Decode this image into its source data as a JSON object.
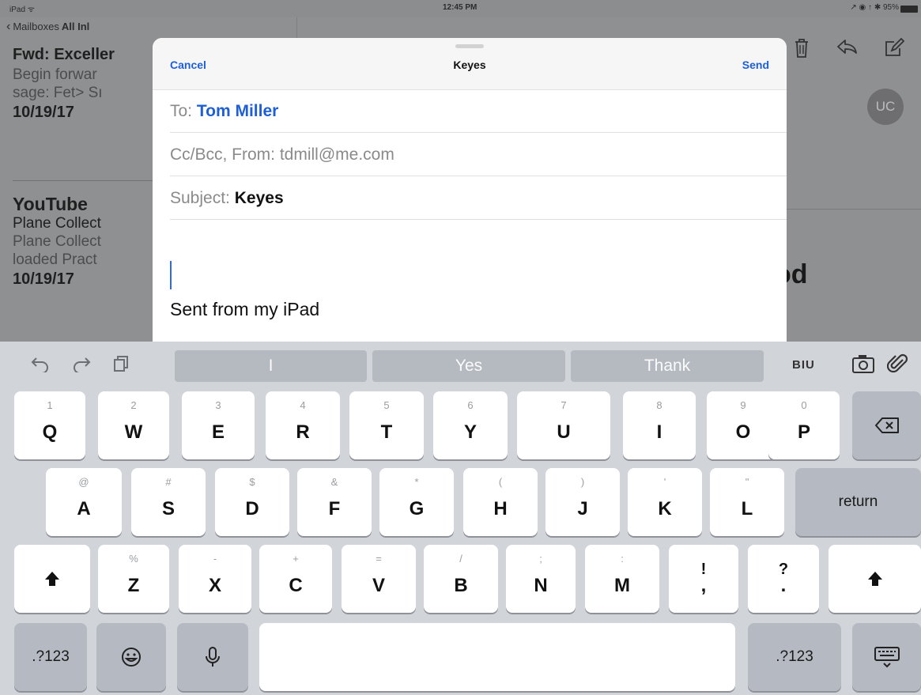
{
  "status_bar": {
    "left": "iPad ᯤ",
    "time": "12:45 PM",
    "right": "↗ ◉ ↑ ✱ 95%"
  },
  "mail_list": {
    "back_label": "Mailboxes",
    "mailbox_title": "All Inl",
    "messages": [
      {
        "sender": "Fwd: Exceller",
        "preview_1": "Begin forwar",
        "preview_2": "sage: Fet> Sı",
        "date": "10/19/17"
      },
      {
        "sender": "YouTube",
        "subject": "Plane Collect",
        "preview_1": "Plane Collect",
        "preview_2": "loaded Pract",
        "date": "10/19/17"
      }
    ]
  },
  "detail": {
    "avatar_initials": "UC",
    "title_fragment": "od"
  },
  "compose": {
    "cancel_label": "Cancel",
    "title": "Keyes",
    "send_label": "Send",
    "to_label": "To:",
    "to_value": "Tom Miller",
    "ccbcc_label": "Cc/Bcc, From: tdmill@me.com",
    "subject_label": "Subject:",
    "subject_value": "Keyes",
    "signature": "Sent from my iPad"
  },
  "keyboard": {
    "suggestions": [
      "I",
      "Yes",
      "Thank"
    ],
    "format_label": "BIU",
    "row1": [
      {
        "sec": "1",
        "key": "Q"
      },
      {
        "sec": "2",
        "key": "W"
      },
      {
        "sec": "3",
        "key": "E"
      },
      {
        "sec": "4",
        "key": "R"
      },
      {
        "sec": "5",
        "key": "T"
      },
      {
        "sec": "6",
        "key": "Y"
      },
      {
        "sec": "7",
        "key": "U"
      },
      {
        "sec": "8",
        "key": "I"
      },
      {
        "sec": "9",
        "key": "O"
      },
      {
        "sec": "0",
        "key": "P"
      }
    ],
    "row2": [
      {
        "sec": "@",
        "key": "A"
      },
      {
        "sec": "#",
        "key": "S"
      },
      {
        "sec": "$",
        "key": "D"
      },
      {
        "sec": "&",
        "key": "F"
      },
      {
        "sec": "*",
        "key": "G"
      },
      {
        "sec": "(",
        "key": "H"
      },
      {
        "sec": ")",
        "key": "J"
      },
      {
        "sec": "'",
        "key": "K"
      },
      {
        "sec": "\"",
        "key": "L"
      }
    ],
    "row3": [
      {
        "sec": "%",
        "key": "Z"
      },
      {
        "sec": "-",
        "key": "X"
      },
      {
        "sec": "+",
        "key": "C"
      },
      {
        "sec": "=",
        "key": "V"
      },
      {
        "sec": "/",
        "key": "B"
      },
      {
        "sec": ";",
        "key": "N"
      },
      {
        "sec": ":",
        "key": "M"
      },
      {
        "sec": "!",
        "key": ","
      },
      {
        "sec": "?",
        "key": "."
      }
    ],
    "return_label": "return",
    "numbers_label": ".?123",
    "numbers_label_right": ".?123"
  }
}
